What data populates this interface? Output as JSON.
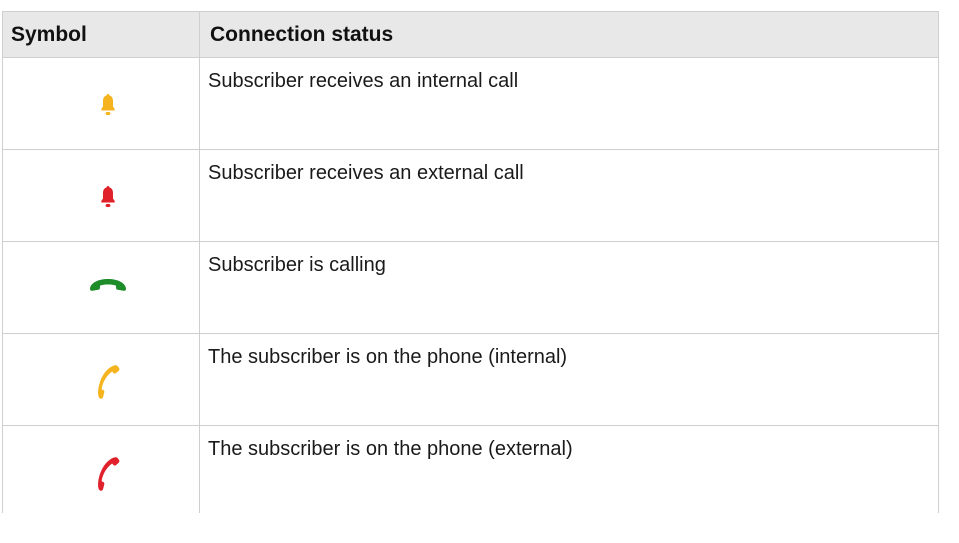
{
  "table": {
    "headers": {
      "symbol": "Symbol",
      "status": "Connection status"
    },
    "rows": [
      {
        "icon": "bell-icon",
        "icon_color": "#f5b41e",
        "status": "Subscriber receives an internal call"
      },
      {
        "icon": "bell-icon",
        "icon_color": "#e0202a",
        "status": "Subscriber receives an external call"
      },
      {
        "icon": "phone-handset-down-icon",
        "icon_color": "#1f8c2a",
        "status": "Subscriber is calling"
      },
      {
        "icon": "phone-handset-icon",
        "icon_color": "#f5b41e",
        "status": "The subscriber is on the phone (internal)"
      },
      {
        "icon": "phone-handset-icon",
        "icon_color": "#e0202a",
        "status": "The subscriber is on the phone (external)"
      }
    ]
  }
}
